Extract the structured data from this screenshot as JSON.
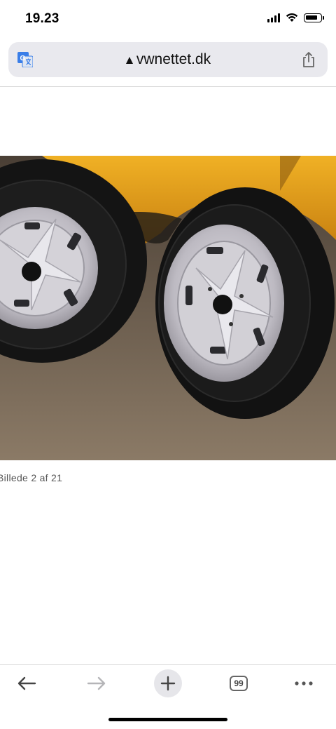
{
  "status_bar": {
    "time": "19.23",
    "battery_level": 0.85
  },
  "address_bar": {
    "url": "vwnettet.dk",
    "translate_icon": "translate-icon",
    "lock_icon": "lock-icon",
    "share_icon": "share-icon"
  },
  "photo": {
    "subject": "two tyres on silver rims beside yellow car",
    "caption": "Billede 2 af 21"
  },
  "toolbar": {
    "back_icon": "arrow-left-icon",
    "forward_icon": "arrow-right-icon",
    "new_tab_icon": "plus-icon",
    "tabs_count": "99",
    "more_icon": "more-icon"
  },
  "colors": {
    "address_bg": "#e9e9ee",
    "car_yellow": "#e7a31a",
    "rim_silver": "#c9c7cc",
    "tyre_black": "#141414",
    "floor": "#7b6a57"
  }
}
